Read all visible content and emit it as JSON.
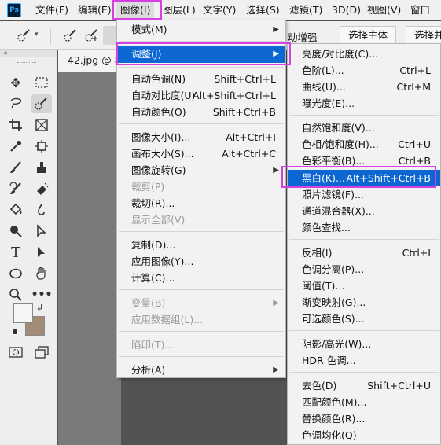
{
  "app": {
    "logo": "Ps"
  },
  "menubar": {
    "items": [
      "文件(F)",
      "编辑(E)",
      "图像(I)",
      "图层(L)",
      "文字(Y)",
      "选择(S)",
      "滤镜(T)",
      "3D(D)",
      "视图(V)",
      "窗口"
    ]
  },
  "options": {
    "fragment": "动增强",
    "subject_btn": "选择主体",
    "combine_btn": "选择并"
  },
  "document": {
    "tab_title": "42.jpg @ 8"
  },
  "image_menu": {
    "items": [
      {
        "label": "模式(M)",
        "shortcut": "",
        "submenu": true
      },
      {
        "label": "调整(J)",
        "shortcut": "",
        "submenu": true
      },
      {
        "label": "自动色调(N)",
        "shortcut": "Shift+Ctrl+L"
      },
      {
        "label": "自动对比度(U)",
        "shortcut": "Alt+Shift+Ctrl+L"
      },
      {
        "label": "自动颜色(O)",
        "shortcut": "Shift+Ctrl+B"
      },
      {
        "label": "图像大小(I)...",
        "shortcut": "Alt+Ctrl+I"
      },
      {
        "label": "画布大小(S)...",
        "shortcut": "Alt+Ctrl+C"
      },
      {
        "label": "图像旋转(G)",
        "shortcut": "",
        "submenu": true
      },
      {
        "label": "裁剪(P)",
        "shortcut": "",
        "disabled": true
      },
      {
        "label": "裁切(R)...",
        "shortcut": ""
      },
      {
        "label": "显示全部(V)",
        "shortcut": "",
        "disabled": true
      },
      {
        "label": "复制(D)...",
        "shortcut": ""
      },
      {
        "label": "应用图像(Y)...",
        "shortcut": ""
      },
      {
        "label": "计算(C)...",
        "shortcut": ""
      },
      {
        "label": "变量(B)",
        "shortcut": "",
        "disabled": true,
        "submenu": true
      },
      {
        "label": "应用数据组(L)...",
        "shortcut": "",
        "disabled": true
      },
      {
        "label": "陷印(T)...",
        "shortcut": "",
        "disabled": true
      },
      {
        "label": "分析(A)",
        "shortcut": "",
        "submenu": true
      }
    ]
  },
  "adjust_menu": {
    "items": [
      {
        "label": "亮度/对比度(C)...",
        "shortcut": ""
      },
      {
        "label": "色阶(L)...",
        "shortcut": "Ctrl+L"
      },
      {
        "label": "曲线(U)...",
        "shortcut": "Ctrl+M"
      },
      {
        "label": "曝光度(E)...",
        "shortcut": ""
      },
      {
        "label": "自然饱和度(V)...",
        "shortcut": ""
      },
      {
        "label": "色相/饱和度(H)...",
        "shortcut": "Ctrl+U"
      },
      {
        "label": "色彩平衡(B)...",
        "shortcut": "Ctrl+B"
      },
      {
        "label": "黑白(K)...",
        "shortcut": "Alt+Shift+Ctrl+B"
      },
      {
        "label": "照片滤镜(F)...",
        "shortcut": ""
      },
      {
        "label": "通道混合器(X)...",
        "shortcut": ""
      },
      {
        "label": "颜色查找...",
        "shortcut": ""
      },
      {
        "label": "反相(I)",
        "shortcut": "Ctrl+I"
      },
      {
        "label": "色调分离(P)...",
        "shortcut": ""
      },
      {
        "label": "阈值(T)...",
        "shortcut": ""
      },
      {
        "label": "渐变映射(G)...",
        "shortcut": ""
      },
      {
        "label": "可选颜色(S)...",
        "shortcut": ""
      },
      {
        "label": "阴影/高光(W)...",
        "shortcut": ""
      },
      {
        "label": "HDR 色调...",
        "shortcut": ""
      },
      {
        "label": "去色(D)",
        "shortcut": "Shift+Ctrl+U"
      },
      {
        "label": "匹配颜色(M)...",
        "shortcut": ""
      },
      {
        "label": "替换颜色(R)...",
        "shortcut": ""
      },
      {
        "label": "色调均化(Q)",
        "shortcut": ""
      }
    ]
  },
  "colors": {
    "highlight": "#0c67d2",
    "annotation": "#d63fe1",
    "foreground": "#f5f5f5",
    "background": "#a28b77"
  }
}
